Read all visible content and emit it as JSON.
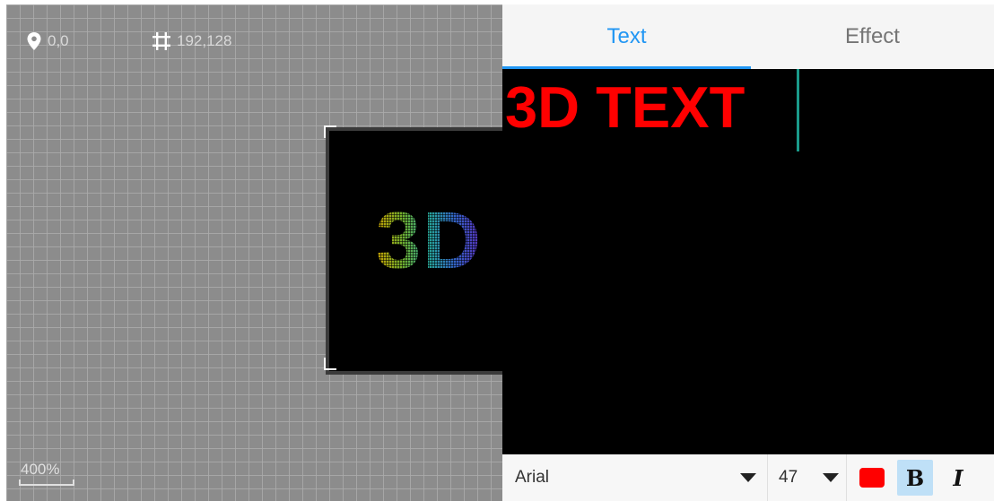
{
  "canvas": {
    "position_readout": "0,0",
    "size_readout": "192,128",
    "zoom_label": "400%",
    "preview_text": "3D",
    "preview_gradient": [
      "#c9a000",
      "#6fae2e",
      "#27a59a",
      "#3461c8",
      "#5a2db8"
    ],
    "icons": {
      "position": "location-pin-icon",
      "size": "crop-grid-icon"
    }
  },
  "tabs": [
    {
      "label": "Text",
      "active": true
    },
    {
      "label": "Effect",
      "active": false
    }
  ],
  "editor": {
    "text": "3D TEXT",
    "text_color": "#ff0000"
  },
  "toolbar": {
    "font_name": "Arial",
    "font_size": "47",
    "color": "#ff0000",
    "bold_label": "B",
    "italic_label": "I",
    "bold_active": true
  },
  "colors": {
    "accent": "#2196f3",
    "caret": "#1a9a8a"
  }
}
